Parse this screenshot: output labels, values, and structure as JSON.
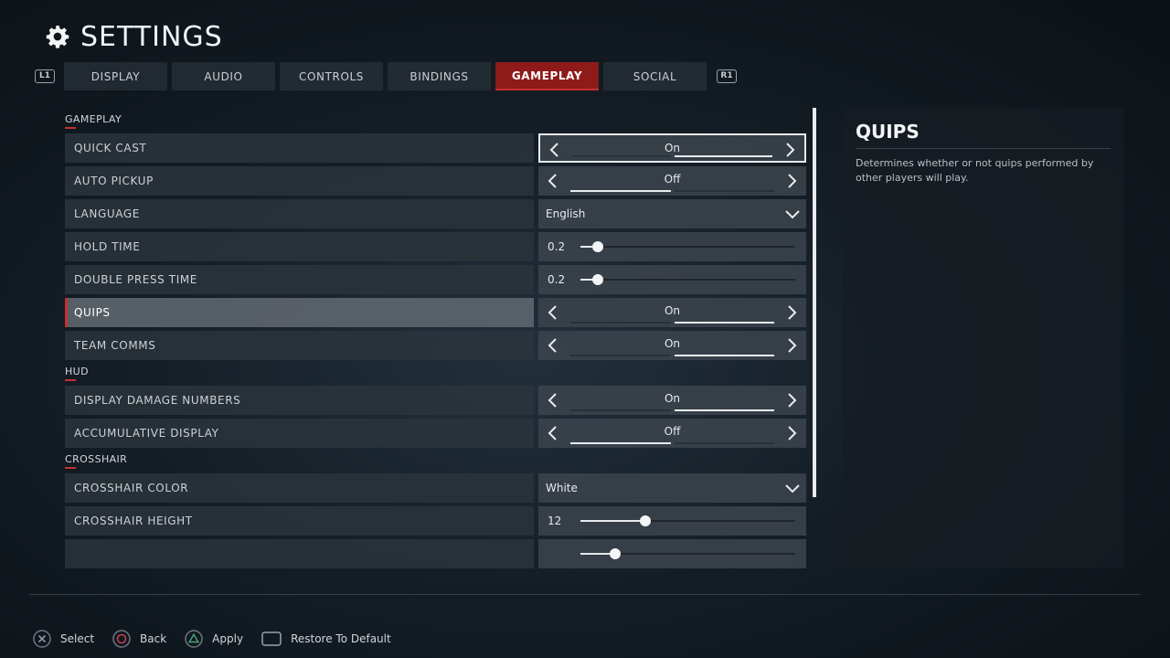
{
  "header": {
    "title": "SETTINGS",
    "icon": "gear-icon"
  },
  "tabs": {
    "left_shoulder": "L1",
    "right_shoulder": "R1",
    "items": [
      {
        "label": "DISPLAY",
        "active": false
      },
      {
        "label": "AUDIO",
        "active": false
      },
      {
        "label": "CONTROLS",
        "active": false
      },
      {
        "label": "BINDINGS",
        "active": false
      },
      {
        "label": "GAMEPLAY",
        "active": true
      },
      {
        "label": "SOCIAL",
        "active": false
      }
    ]
  },
  "sections": [
    {
      "title": "GAMEPLAY",
      "rows": [
        {
          "label": "QUICK CAST",
          "type": "selector",
          "value": "On",
          "option_index": 1,
          "focused": true
        },
        {
          "label": "AUTO PICKUP",
          "type": "selector",
          "value": "Off",
          "option_index": 0
        },
        {
          "label": "LANGUAGE",
          "type": "dropdown",
          "value": "English"
        },
        {
          "label": "HOLD TIME",
          "type": "slider",
          "value": "0.2",
          "fraction": 0.08
        },
        {
          "label": "DOUBLE PRESS TIME",
          "type": "slider",
          "value": "0.2",
          "fraction": 0.08
        },
        {
          "label": "QUIPS",
          "type": "selector",
          "value": "On",
          "option_index": 1,
          "selected": true
        },
        {
          "label": "TEAM COMMS",
          "type": "selector",
          "value": "On",
          "option_index": 1
        }
      ]
    },
    {
      "title": "HUD",
      "rows": [
        {
          "label": "DISPLAY DAMAGE NUMBERS",
          "type": "selector",
          "value": "On",
          "option_index": 1
        },
        {
          "label": "ACCUMULATIVE DISPLAY",
          "type": "selector",
          "value": "Off",
          "option_index": 0
        }
      ]
    },
    {
      "title": "CROSSHAIR",
      "rows": [
        {
          "label": "CROSSHAIR COLOR",
          "type": "dropdown",
          "value": "White"
        },
        {
          "label": "CROSSHAIR HEIGHT",
          "type": "slider",
          "value": "12",
          "fraction": 0.3
        },
        {
          "label": "",
          "type": "slider",
          "value": "",
          "fraction": 0.16
        }
      ]
    }
  ],
  "info": {
    "title": "QUIPS",
    "description": "Determines whether or not quips performed by other players will play."
  },
  "footer": {
    "hints": [
      {
        "icon": "cross-button-icon",
        "label": "Select"
      },
      {
        "icon": "circle-button-icon",
        "label": "Back"
      },
      {
        "icon": "triangle-button-icon",
        "label": "Apply"
      },
      {
        "icon": "touchpad-button-icon",
        "label": "Restore To Default"
      }
    ]
  },
  "colors": {
    "accent": "#8e1a1a",
    "accent_line": "#c43131",
    "cross": "#8a96a8",
    "circle": "#c04050",
    "triangle": "#4aa078"
  }
}
